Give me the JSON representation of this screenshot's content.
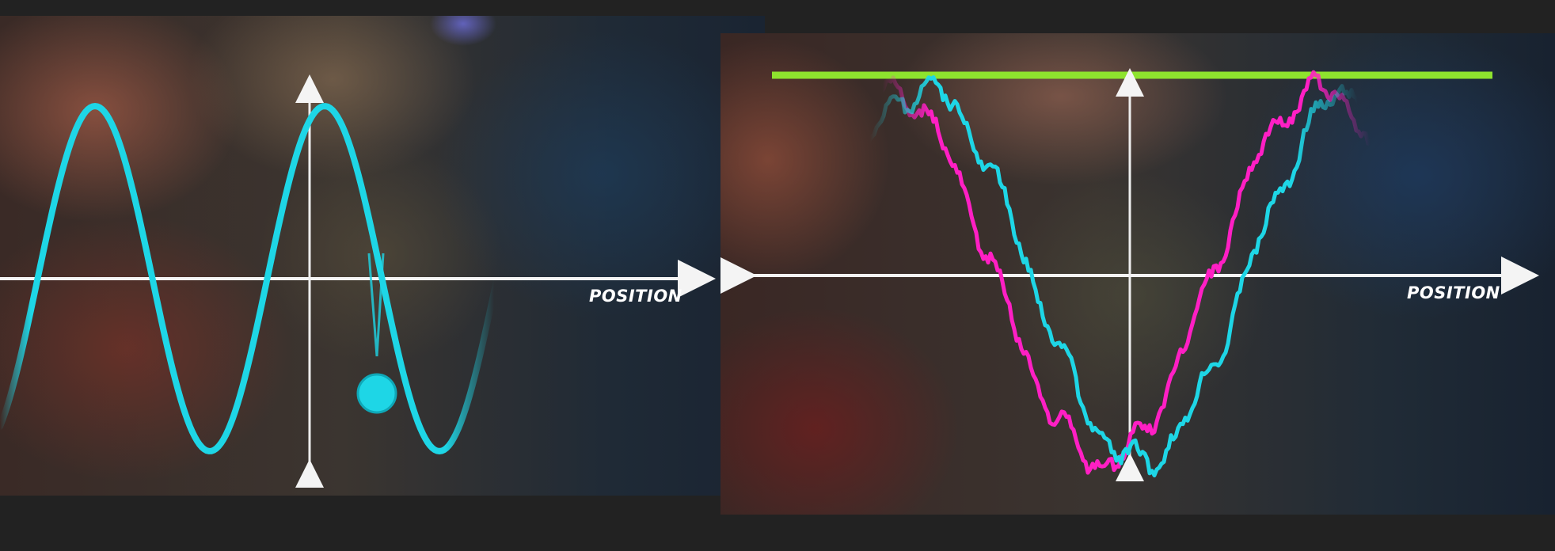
{
  "left_panel": {
    "x_axis_label": "POSITION",
    "wave": {
      "color": "#1ed6e6",
      "cycles_visible": 3.4
    }
  },
  "right_panel": {
    "x_axis_label": "POSITION",
    "colors": {
      "cyan": "#1ed6e6",
      "magenta": "#ff1fc4",
      "bar": "#8ee32e"
    }
  }
}
